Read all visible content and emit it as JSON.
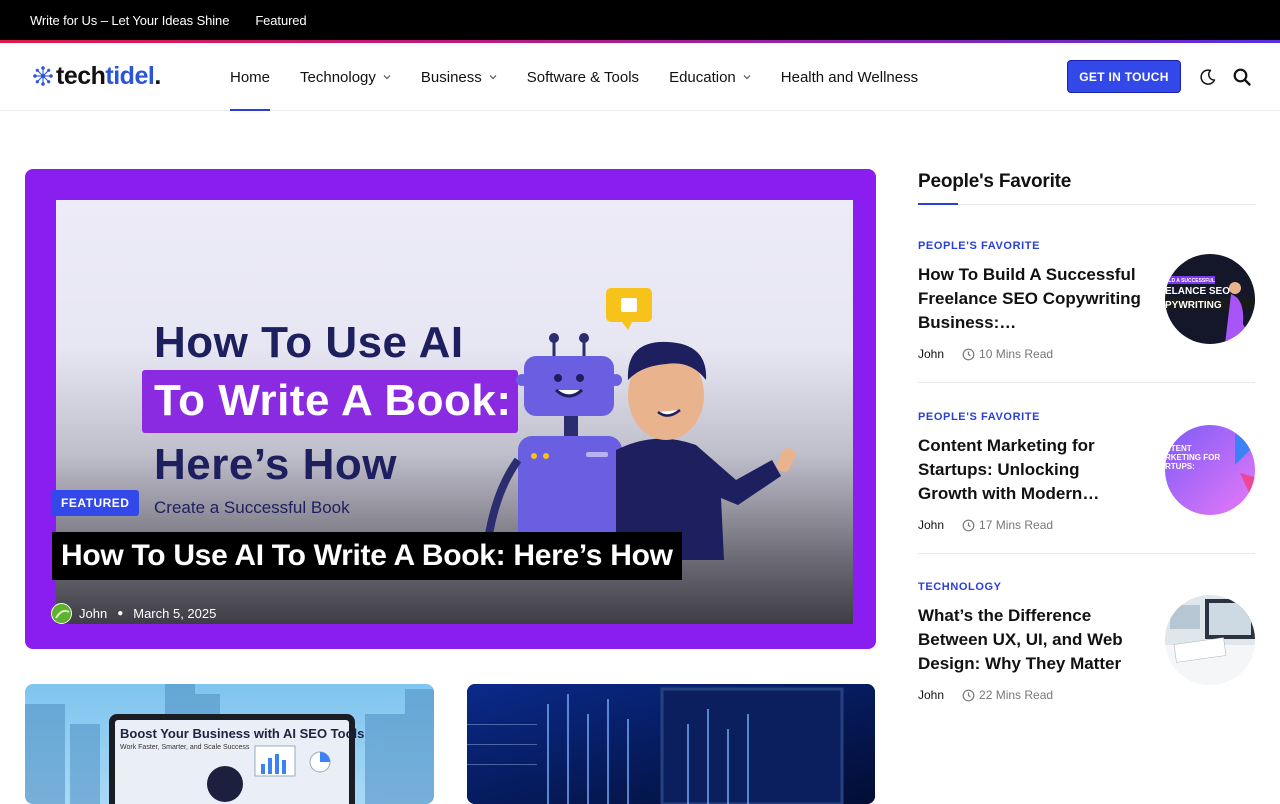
{
  "topbar": {
    "links": [
      "Write for Us – Let Your Ideas Shine",
      "Featured"
    ]
  },
  "logo": {
    "part1": "tech",
    "part2": "tidel",
    "dot": "."
  },
  "nav": {
    "items": [
      {
        "label": "Home",
        "dropdown": false,
        "active": true
      },
      {
        "label": "Technology",
        "dropdown": true
      },
      {
        "label": "Business",
        "dropdown": true
      },
      {
        "label": "Software & Tools",
        "dropdown": false
      },
      {
        "label": "Education",
        "dropdown": true
      },
      {
        "label": "Health and Wellness",
        "dropdown": false
      }
    ],
    "cta": "GET IN TOUCH",
    "icons": [
      "moon-icon",
      "search-icon"
    ]
  },
  "hero": {
    "image_text": {
      "line1": "How To Use AI",
      "line2": "To Write A Book:",
      "line3": "Here’s How",
      "line4": "Create a Successful Book"
    },
    "badge": "FEATURED",
    "title": "How To Use AI To Write A Book: Here’s How",
    "author": "John",
    "date": "March 5, 2025"
  },
  "cards": [
    {
      "image_text": {
        "title": "Boost Your Business with AI SEO Tools",
        "subtitle": "Work Faster, Smarter, and Scale Success"
      }
    },
    {
      "image_text": {}
    }
  ],
  "sidebar": {
    "heading": "People's Favorite",
    "posts": [
      {
        "category": "PEOPLE'S FAVORITE",
        "title": "How To Build A Successful Freelance SEO Copywriting Business:…",
        "author": "John",
        "read": "10 Mins Read",
        "thumb_text": {
          "a": "ILD A SUCCESSFUL",
          "b": "ELANCE SEO",
          "c": "PYWRITING"
        }
      },
      {
        "category": "PEOPLE'S FAVORITE",
        "title": "Content Marketing for Startups: Unlocking Growth with Modern…",
        "author": "John",
        "read": "17 Mins Read",
        "thumb_text": {
          "a": "NTENT",
          "b": "RKETING FOR",
          "c": "RTUPS:"
        }
      },
      {
        "category": "TECHNOLOGY",
        "title": "What’s the Difference Between UX, UI, and Web Design: Why They Matter",
        "author": "John",
        "read": "22 Mins Read"
      }
    ]
  },
  "colors": {
    "accent": "#3248e8",
    "hero_frame": "#8a1ef0",
    "topbar": "#000000"
  }
}
